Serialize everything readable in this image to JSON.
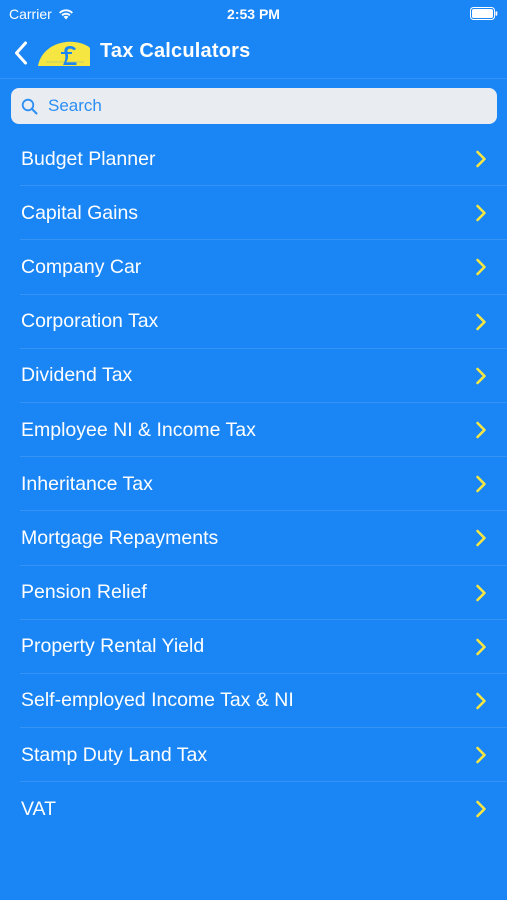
{
  "status_bar": {
    "carrier": "Carrier",
    "time": "2:53 PM"
  },
  "nav": {
    "title": "Tax Calculators",
    "back_icon": "chevron-left-icon",
    "logo": "pound-sign-logo"
  },
  "search": {
    "placeholder": "Search",
    "value": ""
  },
  "calculators": [
    {
      "label": "Budget Planner"
    },
    {
      "label": "Capital Gains"
    },
    {
      "label": "Company Car"
    },
    {
      "label": "Corporation Tax"
    },
    {
      "label": "Dividend Tax"
    },
    {
      "label": "Employee NI & Income Tax"
    },
    {
      "label": "Inheritance Tax"
    },
    {
      "label": "Mortgage Repayments"
    },
    {
      "label": "Pension Relief"
    },
    {
      "label": "Property Rental Yield"
    },
    {
      "label": "Self-employed Income Tax & NI"
    },
    {
      "label": "Stamp Duty Land Tax"
    },
    {
      "label": "VAT"
    }
  ],
  "colors": {
    "background": "#1a85f5",
    "chevron": "#f5e642",
    "logo": "#f5e642",
    "text": "#ffffff"
  }
}
